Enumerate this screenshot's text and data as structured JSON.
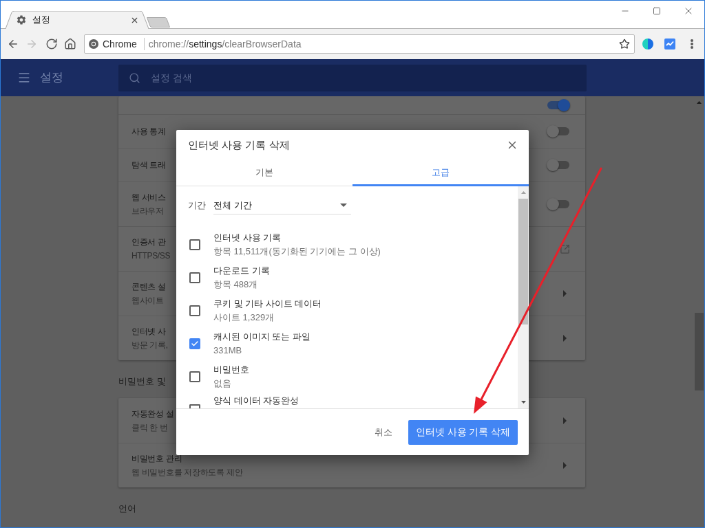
{
  "browser": {
    "tabs": [
      {
        "title": "설정",
        "selected": true
      }
    ],
    "navigation": {
      "back_disabled": false,
      "forward_disabled": true
    },
    "omnibox": {
      "chip": "Chrome",
      "url": "chrome://**settings**/clearBrowserData",
      "bookmarked": false
    }
  },
  "settings_header": {
    "title": "설정",
    "search_placeholder": "설정 검색"
  },
  "settings_page": {
    "sections": [
      {
        "rows": [
          {
            "kind": "toggle",
            "on": true
          },
          {
            "kind": "toggle",
            "title": "사용 통계",
            "on": false
          },
          {
            "kind": "toggle",
            "title": "탐색 트래",
            "on": false
          },
          {
            "kind": "toggle",
            "title": "웹 서비스",
            "subtitle": "브라우저",
            "on": false
          },
          {
            "kind": "link",
            "title": "인증서 관",
            "subtitle": "HTTPS/SS"
          },
          {
            "kind": "submenu",
            "title": "콘텐츠 설",
            "subtitle": "웹사이트"
          },
          {
            "kind": "submenu",
            "title": "인터넷 사",
            "subtitle": "방문 기록,"
          }
        ]
      },
      {
        "heading": "비밀번호 및",
        "rows": [
          {
            "kind": "submenu",
            "title": "자동완성 설",
            "subtitle": "클릭 한 번"
          },
          {
            "kind": "submenu",
            "title": "비밀번호 관리",
            "subtitle": "웹 비밀번호를 저장하도록 제안"
          }
        ]
      },
      {
        "heading": "언어"
      }
    ]
  },
  "dialog": {
    "title": "인터넷 사용 기록 삭제",
    "tabs": [
      {
        "label": "기본",
        "selected": false
      },
      {
        "label": "고급",
        "selected": true
      }
    ],
    "time_range": {
      "label": "기간",
      "value": "전체 기간"
    },
    "items": [
      {
        "title": "인터넷 사용 기록",
        "detail": "항목 11,511개(동기화된 기기에는 그 이상)",
        "checked": false
      },
      {
        "title": "다운로드 기록",
        "detail": "항목 488개",
        "checked": false
      },
      {
        "title": "쿠키 및 기타 사이트 데이터",
        "detail": "사이트 1,329개",
        "checked": false
      },
      {
        "title": "캐시된 이미지 또는 파일",
        "detail": "331MB",
        "checked": true
      },
      {
        "title": "비밀번호",
        "detail": "없음",
        "checked": false
      },
      {
        "title": "양식 데이터 자동완성",
        "checked": false
      }
    ],
    "cancel": "취소",
    "confirm": "인터넷 사용 기록 삭제"
  }
}
